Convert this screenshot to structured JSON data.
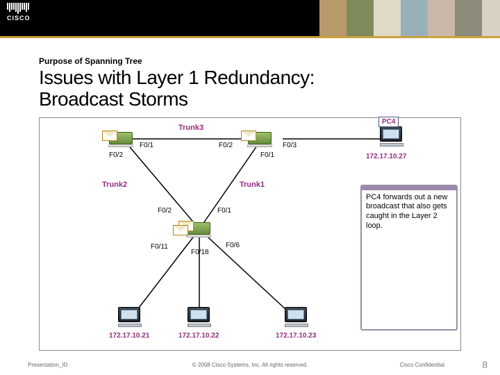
{
  "logo_text": "CISCO",
  "eyebrow": "Purpose of Spanning Tree",
  "title_l1": "Issues with Layer 1 Redundancy:",
  "title_l2": "Broadcast Storms",
  "trunks": {
    "t1": "Trunk1",
    "t2": "Trunk2",
    "t3": "Trunk3"
  },
  "ports": {
    "s1_f02": "F0/2",
    "s1_f01": "F0/1",
    "s2_f02_top": "F0/2",
    "s2_f01_top": "F0/1",
    "s2_f03": "F0/3",
    "s3_f02": "F0/2",
    "s3_f01": "F0/1",
    "s3_f011": "F0/11",
    "s3_f018": "F0/18",
    "s3_f06": "F0/6"
  },
  "pcs": {
    "pc4": "PC4",
    "pc4_ip": "172.17.10.27",
    "pc1_ip": "172.17.10.21",
    "pc2_ip": "172.17.10.22",
    "pc3_ip": "172.17.10.23"
  },
  "note_text": "PC4 forwards out a new broadcast that also gets caught in the Layer 2 loop.",
  "footer": {
    "id": "Presentation_ID",
    "copy": "© 2008 Cisco Systems, Inc. All rights reserved.",
    "conf": "Cisco Confidential",
    "page": "8"
  }
}
